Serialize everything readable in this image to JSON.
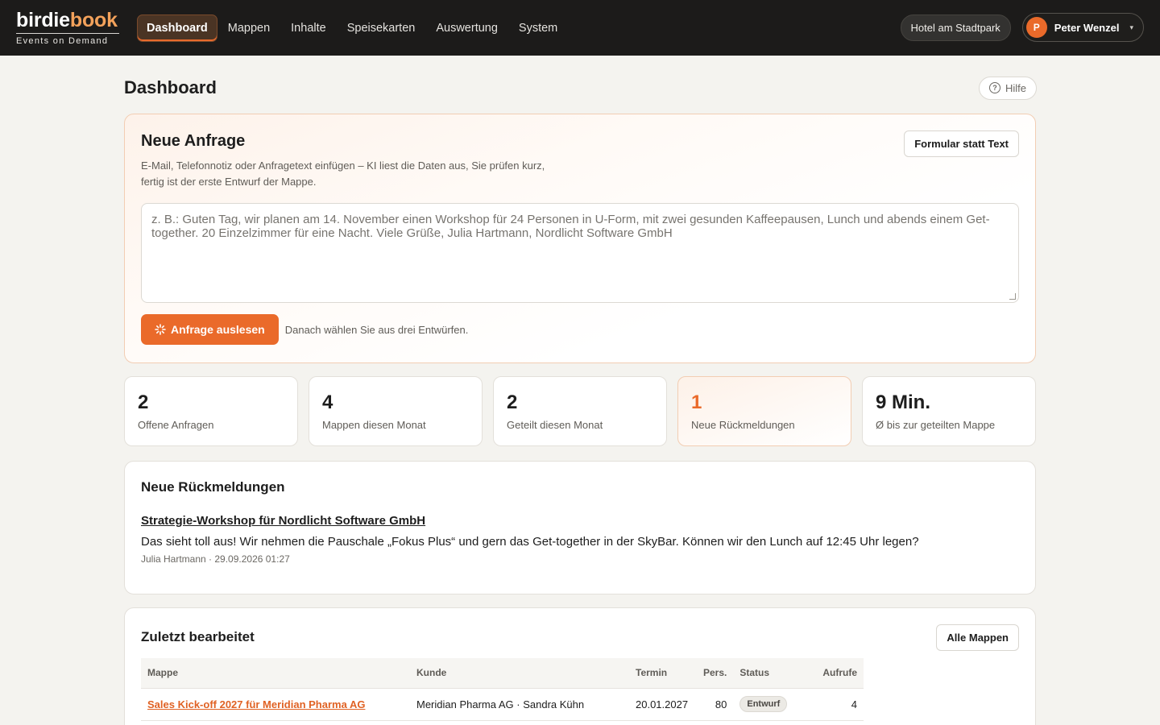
{
  "brand": {
    "name_a": "birdie",
    "name_b": "book",
    "tagline": "Events on Demand"
  },
  "nav": {
    "items": [
      {
        "label": "Dashboard",
        "active": true
      },
      {
        "label": "Mappen",
        "active": false
      },
      {
        "label": "Inhalte",
        "active": false
      },
      {
        "label": "Speisekarten",
        "active": false
      },
      {
        "label": "Auswertung",
        "active": false
      },
      {
        "label": "System",
        "active": false
      }
    ]
  },
  "header": {
    "hotel": "Hotel am Stadtpark",
    "user": {
      "initial": "P",
      "name": "Peter Wenzel",
      "caret": "▾"
    }
  },
  "page": {
    "title": "Dashboard",
    "help_label": "Hilfe",
    "help_icon": "?"
  },
  "inquiry": {
    "title": "Neue Anfrage",
    "description_line1": "E-Mail, Telefonnotiz oder Anfragetext einfügen – KI liest die Daten aus, Sie prüfen kurz,",
    "description_line2": "fertig ist der erste Entwurf der Mappe.",
    "form_button": "Formular statt Text",
    "placeholder": "z. B.: Guten Tag, wir planen am 14. November einen Workshop für 24 Personen in U-Form, mit zwei gesunden Kaffeepausen, Lunch und abends einem Get-together. 20 Einzelzimmer für eine Nacht. Viele Grüße, Julia Hartmann, Nordlicht Software GmbH",
    "submit_label": "Anfrage auslesen",
    "submit_icon": "sparkle-icon",
    "hint": "Danach wählen Sie aus drei Entwürfen."
  },
  "stats": [
    {
      "value": "2",
      "label": "Offene Anfragen",
      "highlight": false
    },
    {
      "value": "4",
      "label": "Mappen diesen Monat",
      "highlight": false
    },
    {
      "value": "2",
      "label": "Geteilt diesen Monat",
      "highlight": false
    },
    {
      "value": "1",
      "label": "Neue Rückmeldungen",
      "highlight": true
    },
    {
      "value": "9 Min.",
      "label": "Ø bis zur geteilten Mappe",
      "highlight": false
    }
  ],
  "feedback": {
    "title": "Neue Rückmeldungen",
    "items": [
      {
        "subject": "Strategie-Workshop für Nordlicht Software GmbH",
        "message": "Das sieht toll aus! Wir nehmen die Pauschale „Fokus Plus“ und gern das Get-together in der SkyBar. Können wir den Lunch auf 12:45 Uhr legen?",
        "meta": "Julia Hartmann · 29.09.2026 01:27"
      }
    ]
  },
  "recent": {
    "title": "Zuletzt bearbeitet",
    "all_button": "Alle Mappen",
    "columns": [
      "Mappe",
      "Kunde",
      "Termin",
      "Pers.",
      "Status",
      "Aufrufe"
    ],
    "rows": [
      {
        "mappe": "Sales Kick-off 2027 für Meridian Pharma AG",
        "kunde": "Meridian Pharma AG · Sandra Kühn",
        "termin": "20.01.2027",
        "pers": "80",
        "status": "Entwurf",
        "aufrufe": "4"
      }
    ]
  },
  "colors": {
    "accent": "#ea6a2a",
    "topbar": "#1c1b1a",
    "background": "#f4f3ef"
  }
}
